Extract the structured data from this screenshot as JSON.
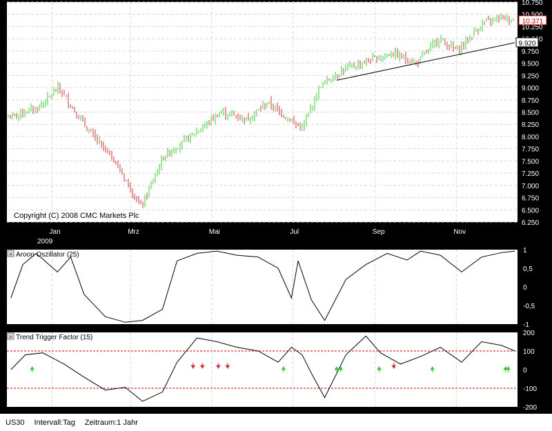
{
  "window": {
    "background": "#000000"
  },
  "colors": {
    "panel_bg": "#ffffff",
    "grid": "#d9d9d9",
    "up": "#33cc33",
    "down": "#cc3333",
    "line": "#000000",
    "threshold": "#dd0000",
    "price_badge": "#cc0000"
  },
  "price_panel": {
    "copyright": "Copyright (C) 2008 CMC Markets Plc",
    "x_ticks": [
      "Jan",
      "Mrz",
      "Mai",
      "Jul",
      "Sep",
      "Nov"
    ],
    "x_year": "2009",
    "y_ticks": [
      "6.250",
      "6.500",
      "6.750",
      "7.000",
      "7.250",
      "7.500",
      "7.750",
      "8.000",
      "8.250",
      "8.500",
      "8.750",
      "9.000",
      "9.250",
      "9.500",
      "9.750",
      "10.000",
      "10.250",
      "10.500",
      "10.750"
    ],
    "last_price": "10.371",
    "trendline_value": "9.920"
  },
  "aroon_panel": {
    "title": "Aroon Oszillator (25)",
    "y_ticks": [
      "1",
      "0,5",
      "0",
      "-0,5",
      "-1"
    ]
  },
  "ttf_panel": {
    "title": "Trend Trigger Factor (15)",
    "y_ticks": [
      "200",
      "100",
      "0",
      "-100",
      "-200"
    ]
  },
  "status": {
    "symbol": "US30",
    "interval": "Intervall:Tag",
    "period": "Zeitraum:1 Jahr"
  },
  "chart_data": [
    {
      "type": "ohlc",
      "ylim": [
        6250,
        10750
      ],
      "x_ticks": [
        "Jan",
        "Mrz",
        "Mai",
        "Jul",
        "Sep",
        "Nov"
      ],
      "close_path": {
        "dates": [
          "2008-12-01",
          "2008-12-22",
          "2009-01-06",
          "2009-01-26",
          "2009-02-17",
          "2009-03-09",
          "2009-03-26",
          "2009-04-20",
          "2009-05-08",
          "2009-05-28",
          "2009-06-12",
          "2009-07-08",
          "2009-07-22",
          "2009-08-07",
          "2009-08-26",
          "2009-09-14",
          "2009-10-02",
          "2009-10-19",
          "2009-11-02",
          "2009-11-20",
          "2009-12-04",
          "2009-12-15"
        ],
        "values": [
          8400,
          8600,
          9000,
          8200,
          7500,
          6550,
          7600,
          8100,
          8500,
          8350,
          8700,
          8150,
          9050,
          9350,
          9550,
          9700,
          9500,
          10000,
          9750,
          10300,
          10450,
          10371
        ]
      },
      "trendline": {
        "from": [
          "2009-08-03",
          9150
        ],
        "to": [
          "2009-12-15",
          9920
        ]
      },
      "last": 10371
    },
    {
      "type": "line",
      "name": "Aroon Oszillator (25)",
      "ylim": [
        -1,
        1
      ],
      "dates": [
        "2008-12-01",
        "2008-12-10",
        "2008-12-20",
        "2009-01-05",
        "2009-01-15",
        "2009-01-25",
        "2009-02-10",
        "2009-02-25",
        "2009-03-10",
        "2009-03-25",
        "2009-04-05",
        "2009-04-20",
        "2009-05-05",
        "2009-05-20",
        "2009-06-05",
        "2009-06-20",
        "2009-06-30",
        "2009-07-05",
        "2009-07-15",
        "2009-07-25",
        "2009-08-10",
        "2009-08-25",
        "2009-09-10",
        "2009-09-25",
        "2009-10-05",
        "2009-10-20",
        "2009-11-05",
        "2009-11-20",
        "2009-12-05",
        "2009-12-15"
      ],
      "values": [
        -0.3,
        0.6,
        0.9,
        0.4,
        0.8,
        -0.2,
        -0.8,
        -0.95,
        -0.9,
        -0.6,
        0.7,
        0.9,
        0.96,
        0.85,
        0.8,
        0.5,
        -0.3,
        0.7,
        -0.35,
        -0.9,
        0.2,
        0.6,
        0.9,
        0.72,
        0.96,
        0.85,
        0.4,
        0.8,
        0.92,
        0.96
      ]
    },
    {
      "type": "line",
      "name": "Trend Trigger Factor (15)",
      "ylim": [
        -200,
        200
      ],
      "thresholds": [
        100,
        -100
      ],
      "dates": [
        "2008-12-01",
        "2008-12-12",
        "2008-12-25",
        "2009-01-10",
        "2009-01-25",
        "2009-02-10",
        "2009-02-25",
        "2009-03-10",
        "2009-03-25",
        "2009-04-05",
        "2009-04-20",
        "2009-05-05",
        "2009-05-20",
        "2009-06-05",
        "2009-06-20",
        "2009-06-30",
        "2009-07-08",
        "2009-07-15",
        "2009-07-25",
        "2009-08-10",
        "2009-08-25",
        "2009-09-05",
        "2009-09-20",
        "2009-10-05",
        "2009-10-20",
        "2009-11-05",
        "2009-11-20",
        "2009-12-05",
        "2009-12-15"
      ],
      "values": [
        0,
        80,
        90,
        30,
        -40,
        -110,
        -95,
        -170,
        -120,
        40,
        170,
        150,
        120,
        100,
        40,
        120,
        80,
        -20,
        -150,
        80,
        180,
        90,
        30,
        70,
        120,
        40,
        150,
        130,
        100
      ],
      "signals_up": [
        "2008-12-17",
        "2009-06-24",
        "2009-08-03",
        "2009-08-06",
        "2009-09-04",
        "2009-10-14",
        "2009-12-08",
        "2009-12-10"
      ],
      "signals_down": [
        "2009-04-17",
        "2009-04-24",
        "2009-05-06",
        "2009-05-13",
        "2009-09-15"
      ]
    }
  ]
}
